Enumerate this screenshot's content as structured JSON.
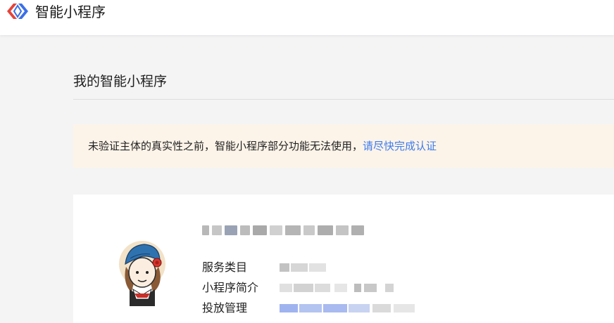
{
  "header": {
    "logo_icon": "smart-program-logo",
    "app_title": "智能小程序"
  },
  "main": {
    "page_title": "我的智能小程序",
    "notice": {
      "text": "未验证主体的真实性之前，智能小程序部分功能无法使用，",
      "link": "请尽快完成认证",
      "background": "#fdf4e9",
      "link_color": "#3c7bef"
    },
    "card": {
      "fields": [
        {
          "label": "服务类目"
        },
        {
          "label": "小程序简介"
        },
        {
          "label": "投放管理"
        }
      ]
    }
  }
}
